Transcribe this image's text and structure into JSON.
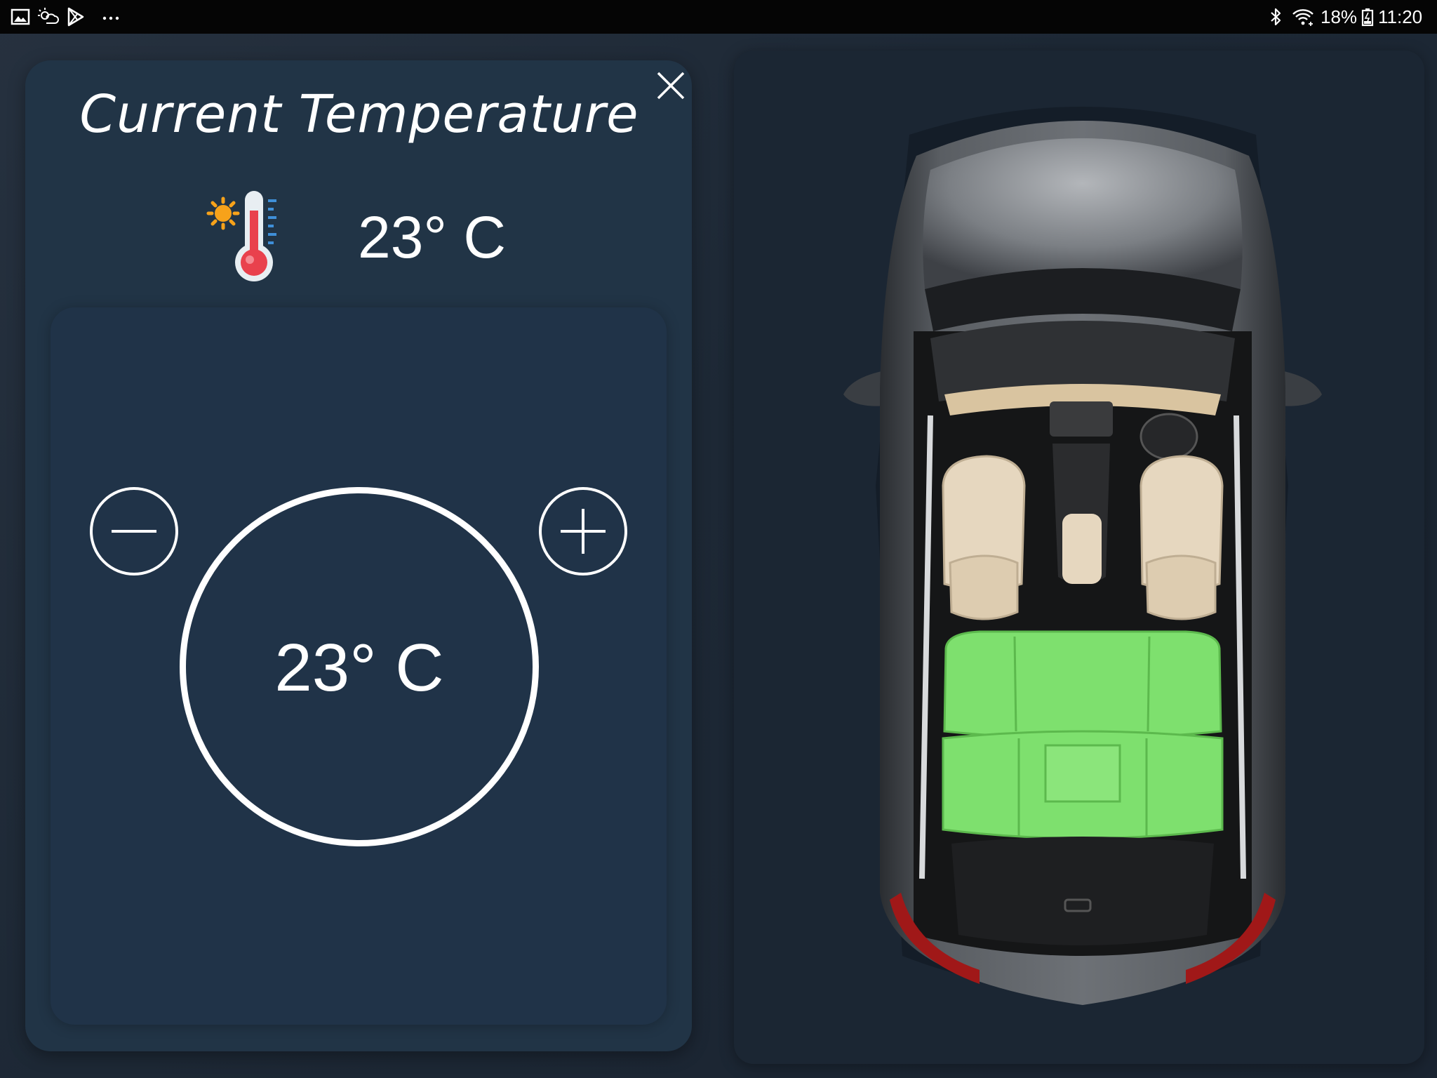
{
  "status_bar": {
    "left_icons": [
      "gallery-icon",
      "weather-icon",
      "play-store-icon",
      "more-dots-icon"
    ],
    "right_icons": [
      "bluetooth-icon",
      "wifi-icon",
      "battery-icon"
    ],
    "battery": "18%",
    "time": "11:20"
  },
  "panel": {
    "title": "Current Temperature",
    "close_icon": "close-icon",
    "thermometer_icon": "thermometer-sun-icon",
    "current_temp": "23° C"
  },
  "control": {
    "set_temp": "23° C",
    "decrease_icon": "minus-icon",
    "increase_icon": "plus-icon"
  },
  "car_view": {
    "selected_zone": "rear seats",
    "highlight_color": "#7ee06e",
    "seat_color": "#e6d7bf",
    "body_color": "#4b4f55"
  }
}
